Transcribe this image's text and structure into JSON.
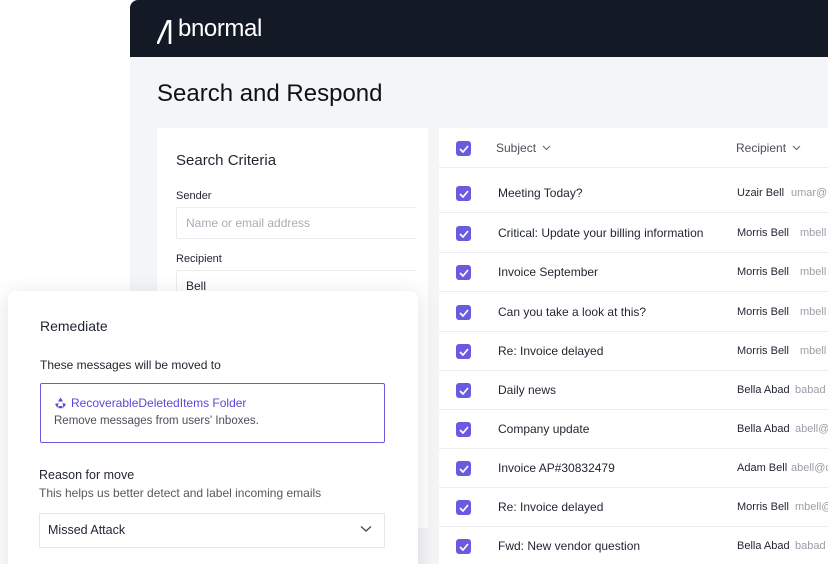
{
  "brand": {
    "name": "bnormal"
  },
  "page": {
    "title": "Search and Respond"
  },
  "criteria": {
    "title": "Search Criteria",
    "sender_label": "Sender",
    "sender_placeholder": "Name or email address",
    "recipient_label": "Recipient",
    "recipient_value": "Bell"
  },
  "results": {
    "columns": {
      "subject": "Subject",
      "recipient": "Recipient"
    },
    "rows": [
      {
        "subject": "Meeting Today?",
        "recipient_name": "Uzair Bell",
        "recipient_email": "umar@"
      },
      {
        "subject": "Critical: Update your billing information",
        "recipient_name": "Morris Bell",
        "recipient_email": "mbell"
      },
      {
        "subject": "Invoice September",
        "recipient_name": "Morris Bell",
        "recipient_email": "mbell"
      },
      {
        "subject": "Can you take a look at this?",
        "recipient_name": "Morris Bell",
        "recipient_email": "mbell"
      },
      {
        "subject": "Re: Invoice delayed",
        "recipient_name": "Morris Bell",
        "recipient_email": "mbell"
      },
      {
        "subject": "Daily news",
        "recipient_name": "Bella Abad",
        "recipient_email": "babad"
      },
      {
        "subject": "Company update",
        "recipient_name": "Bella Abad",
        "recipient_email": "abell@"
      },
      {
        "subject": "Invoice AP#30832479",
        "recipient_name": "Adam Bell",
        "recipient_email": "abell@c"
      },
      {
        "subject": "Re: Invoice delayed",
        "recipient_name": "Morris Bell",
        "recipient_email": "mbell@"
      },
      {
        "subject": "Fwd: New vendor question",
        "recipient_name": "Bella Abad",
        "recipient_email": "babad"
      }
    ]
  },
  "remediate": {
    "title": "Remediate",
    "moved_to_label": "These messages will be moved to",
    "folder_name": "RecoverableDeletedItems Folder",
    "folder_description": "Remove messages from users' Inboxes.",
    "reason_label": "Reason for move",
    "reason_help": "This helps us better detect and label incoming emails",
    "reason_selected": "Missed Attack"
  },
  "colors": {
    "accent": "#6a5ae0",
    "topbar": "#131a25",
    "background": "#f4f5f7"
  },
  "icons": {
    "checkbox": "check-icon",
    "sort": "chevron-down-icon",
    "folder": "recycle-icon",
    "select": "chevron-down-icon"
  }
}
